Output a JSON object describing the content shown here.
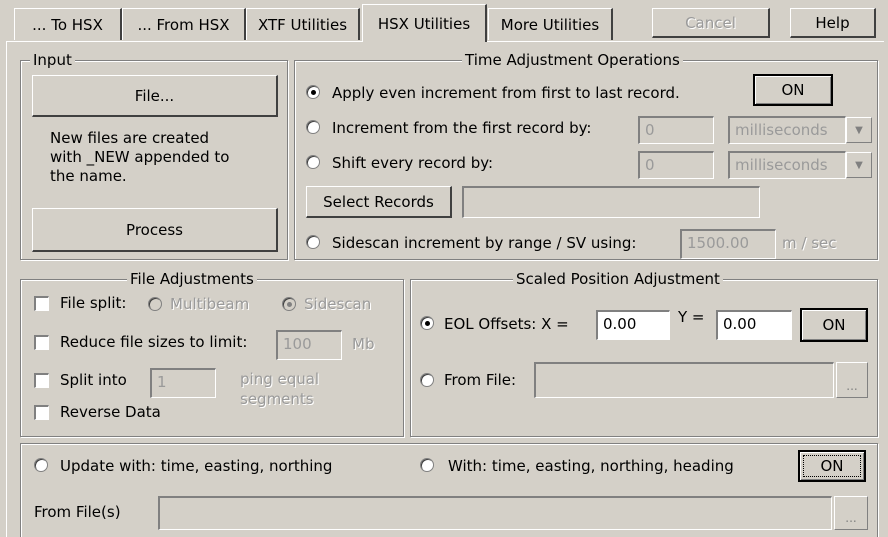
{
  "tabs": [
    {
      "label": "... To HSX"
    },
    {
      "label": "... From HSX"
    },
    {
      "label": "XTF Utilities"
    },
    {
      "label": "HSX Utilities"
    },
    {
      "label": "More Utilities"
    }
  ],
  "top_buttons": {
    "cancel": "Cancel",
    "help": "Help"
  },
  "input_group": {
    "legend": "Input",
    "file_button": "File...",
    "note": "New files are created\nwith _NEW appended to\nthe name.",
    "process_button": "Process"
  },
  "time_group": {
    "legend": "Time Adjustment Operations",
    "apply_even": "Apply even increment from first to last record.",
    "on_button": "ON",
    "increment_label": "Increment from the first record by:",
    "increment_value": "0",
    "increment_unit": "milliseconds",
    "shift_label": "Shift every record by:",
    "shift_value": "0",
    "shift_unit": "milliseconds",
    "select_records_button": "Select Records",
    "select_records_value": "",
    "sidescan_label": "Sidescan increment by range / SV using:",
    "sidescan_value": "1500.00",
    "sidescan_unit": "m / sec"
  },
  "file_adjust_group": {
    "legend": "File Adjustments",
    "file_split_label": "File split:",
    "multibeam_label": "Multibeam",
    "sidescan_label": "Sidescan",
    "reduce_label": "Reduce file sizes to limit:",
    "reduce_value": "100",
    "reduce_unit": "Mb",
    "split_into_label": "Split into",
    "split_into_value": "1",
    "split_unit_line1": "ping equal",
    "split_unit_line2": "segments",
    "reverse_label": "Reverse Data"
  },
  "scaled_group": {
    "legend": "Scaled Position Adjustment",
    "eol_label": "EOL Offsets: X =",
    "x_value": "0.00",
    "y_label": "Y =",
    "y_value": "0.00",
    "on_button": "ON",
    "from_file_label": "From File:",
    "from_file_value": "",
    "browse_button": "..."
  },
  "bottom_group": {
    "update_label": "Update with: time, easting, northing",
    "with_label": "With: time, easting, northing, heading",
    "on_button": "ON",
    "from_files_label": "From File(s)",
    "from_files_value": "",
    "browse_button": "..."
  },
  "colors": {
    "background": "#d4d0c8",
    "disabled_text": "#9a9a9a"
  }
}
